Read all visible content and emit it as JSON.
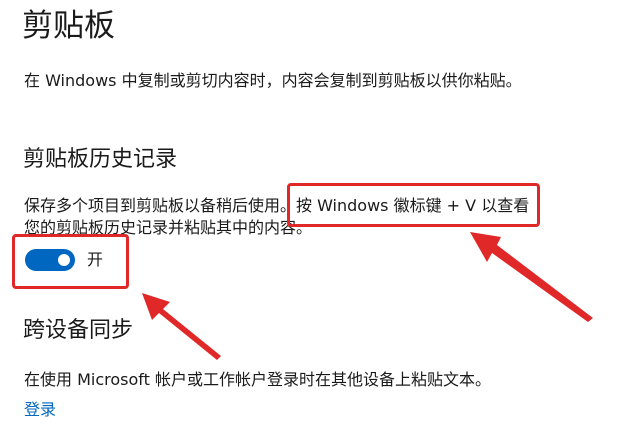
{
  "page": {
    "title": "剪贴板",
    "intro": "在 Windows 中复制或剪切内容时，内容会复制到剪贴板以供你粘贴。"
  },
  "history": {
    "heading": "剪贴板历史记录",
    "description_line1": "保存多个项目到剪贴板以备稍后使用。按 Windows 徽标键 + V 以查看",
    "description_line2": "您的剪贴板历史记录并粘贴其中的内容。",
    "toggle": {
      "checked": true,
      "state_label": "开"
    }
  },
  "sync": {
    "heading": "跨设备同步",
    "description": "在使用 Microsoft 帐户或工作帐户登录时在其他设备上粘贴文本。",
    "signin_link": "登录"
  },
  "annotations": {
    "color": "#e02828",
    "accent": "#0067c0"
  }
}
